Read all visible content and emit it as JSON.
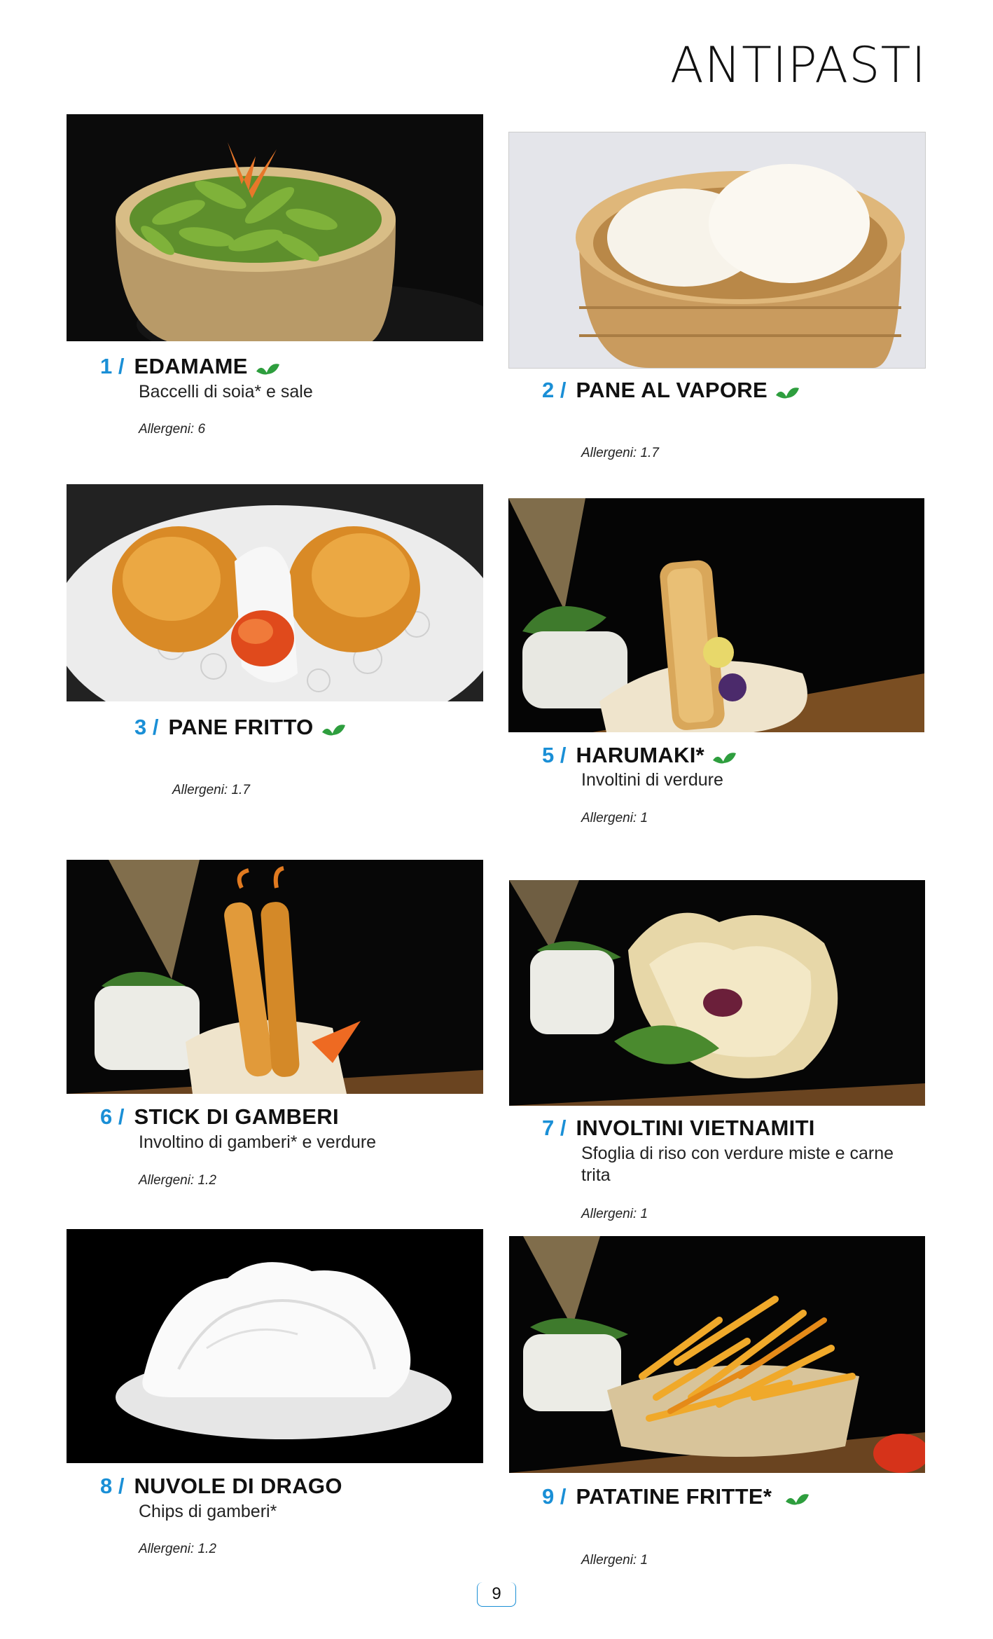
{
  "page": {
    "title": "ANTIPASTI",
    "page_number": "9"
  },
  "colors": {
    "accent": "#1a8fd6",
    "leaf": "#2e9e3e"
  },
  "dishes": [
    {
      "number": "1 /",
      "name": "EDAMAME",
      "vegetarian": true,
      "description": "Baccelli di soia* e sale",
      "allergens": "Allergeni: 6"
    },
    {
      "number": "2 /",
      "name": "PANE AL VAPORE",
      "vegetarian": true,
      "description": "",
      "allergens": "Allergeni: 1.7"
    },
    {
      "number": "3 /",
      "name": "PANE FRITTO",
      "vegetarian": true,
      "description": "",
      "allergens": "Allergeni: 1.7"
    },
    {
      "number": "5 /",
      "name": "HARUMAKI*",
      "vegetarian": true,
      "description": "Involtini di verdure",
      "allergens": "Allergeni: 1"
    },
    {
      "number": "6 /",
      "name": "STICK DI GAMBERI",
      "vegetarian": false,
      "description": "Involtino di gamberi* e verdure",
      "allergens": "Allergeni: 1.2"
    },
    {
      "number": "7 /",
      "name": "INVOLTINI VIETNAMITI",
      "vegetarian": false,
      "description": "Sfoglia di riso con verdure miste e carne trita",
      "allergens": "Allergeni: 1"
    },
    {
      "number": "8 /",
      "name": "NUVOLE DI DRAGO",
      "vegetarian": false,
      "description": "Chips di gamberi*",
      "allergens": "Allergeni: 1.2"
    },
    {
      "number": "9 /",
      "name": "PATATINE FRITTE*",
      "vegetarian": true,
      "description": "",
      "allergens": "Allergeni: 1"
    }
  ]
}
